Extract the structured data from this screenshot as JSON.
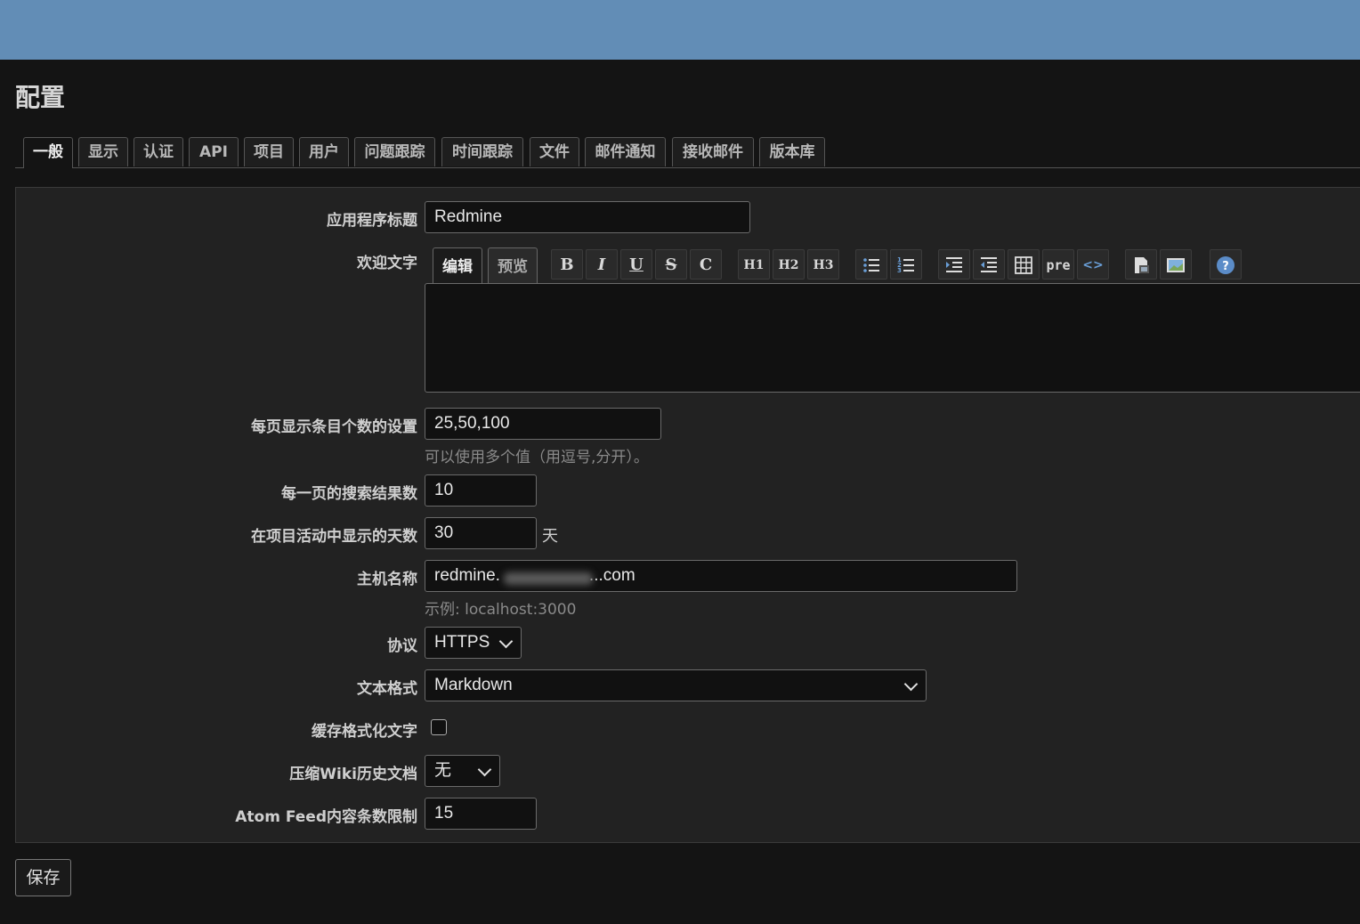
{
  "page": {
    "title": "配置"
  },
  "tabs": [
    {
      "label": "一般",
      "active": true
    },
    {
      "label": "显示"
    },
    {
      "label": "认证"
    },
    {
      "label": "API"
    },
    {
      "label": "项目"
    },
    {
      "label": "用户"
    },
    {
      "label": "问题跟踪"
    },
    {
      "label": "时间跟踪"
    },
    {
      "label": "文件"
    },
    {
      "label": "邮件通知"
    },
    {
      "label": "接收邮件"
    },
    {
      "label": "版本库"
    }
  ],
  "form": {
    "app_title": {
      "label": "应用程序标题",
      "value": "Redmine"
    },
    "welcome": {
      "label": "欢迎文字",
      "edit_tab": "编辑",
      "preview_tab": "预览",
      "toolbar": [
        {
          "icon": "bold-icon",
          "text": "B"
        },
        {
          "icon": "italic-icon",
          "text": "I"
        },
        {
          "icon": "underline-icon",
          "text": "U"
        },
        {
          "icon": "strikethrough-icon",
          "text": "S"
        },
        {
          "icon": "inline-code-icon",
          "text": "C"
        },
        {
          "icon": "heading1-icon",
          "text": "H1"
        },
        {
          "icon": "heading2-icon",
          "text": "H2"
        },
        {
          "icon": "heading3-icon",
          "text": "H3"
        },
        {
          "icon": "unordered-list-icon",
          "text": ""
        },
        {
          "icon": "ordered-list-icon",
          "text": ""
        },
        {
          "icon": "indent-icon",
          "text": ""
        },
        {
          "icon": "outdent-icon",
          "text": ""
        },
        {
          "icon": "table-icon",
          "text": ""
        },
        {
          "icon": "preformatted-icon",
          "text": "pre"
        },
        {
          "icon": "code-highlight-icon",
          "text": "<>"
        },
        {
          "icon": "wiki-link-icon",
          "text": ""
        },
        {
          "icon": "image-icon",
          "text": ""
        },
        {
          "icon": "help-icon",
          "text": "?"
        }
      ]
    },
    "per_page": {
      "label": "每页显示条目个数的设置",
      "value": "25,50,100",
      "hint": "可以使用多个值（用逗号,分开）。"
    },
    "search_results": {
      "label": "每一页的搜索结果数",
      "value": "10"
    },
    "activity_days": {
      "label": "在项目活动中显示的天数",
      "value": "30",
      "unit": "天"
    },
    "host_name": {
      "label": "主机名称",
      "value_prefix": "redmine.",
      "value_suffix": "...com",
      "hint": "示例: localhost:3000"
    },
    "protocol": {
      "label": "协议",
      "value": "HTTPS"
    },
    "text_formatting": {
      "label": "文本格式",
      "value": "Markdown"
    },
    "cache_formatted": {
      "label": "缓存格式化文字",
      "checked": false
    },
    "wiki_compression": {
      "label": "压缩Wiki历史文档",
      "value": "无"
    },
    "feed_limit": {
      "label": "Atom Feed内容条数限制",
      "value": "15"
    }
  },
  "save_button": "保存",
  "colors": {
    "topbar": "#628db6",
    "background": "#141414",
    "panel": "#222222",
    "link_blue": "#6a9fd8"
  }
}
